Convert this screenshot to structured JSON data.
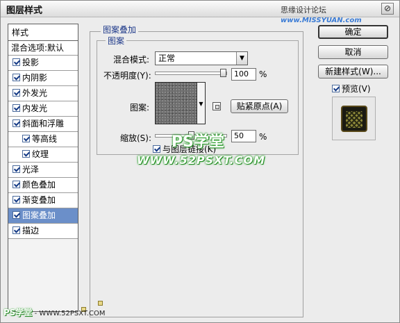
{
  "window": {
    "title": "图层样式",
    "watermark_top_text": "思缘设计论坛",
    "watermark_top_site": "www.MISSYUAN.com",
    "close_glyph": "⊘"
  },
  "sidebar": {
    "header": "样式",
    "blend_options": "混合选项:默认",
    "items": [
      {
        "label": "投影",
        "checked": true
      },
      {
        "label": "内阴影",
        "checked": true
      },
      {
        "label": "外发光",
        "checked": true
      },
      {
        "label": "内发光",
        "checked": true
      },
      {
        "label": "斜面和浮雕",
        "checked": true
      },
      {
        "label": "等高线",
        "checked": true,
        "sub": true
      },
      {
        "label": "纹理",
        "checked": true,
        "sub": true
      },
      {
        "label": "光泽",
        "checked": true
      },
      {
        "label": "颜色叠加",
        "checked": true
      },
      {
        "label": "渐变叠加",
        "checked": true
      },
      {
        "label": "图案叠加",
        "checked": true,
        "selected": true
      },
      {
        "label": "描边",
        "checked": true
      }
    ]
  },
  "panel": {
    "group_title": "图案叠加",
    "subgroup_title": "图案",
    "blend_mode_label": "混合模式:",
    "blend_mode_value": "正常",
    "opacity_label": "不透明度(Y):",
    "opacity_value": "100",
    "opacity_percent": 100,
    "percent_sign": "%",
    "pattern_label": "图案:",
    "snap_origin_button": "贴紧原点(A)",
    "scale_label": "缩放(S):",
    "scale_value": "50",
    "scale_percent": 50,
    "link_label": "与图层链接(K)",
    "link_checked": true
  },
  "buttons": {
    "ok": "确定",
    "cancel": "取消",
    "new_style": "新建样式(W)...",
    "preview_label": "预览(V)",
    "preview_checked": true
  },
  "watermarks": {
    "ps_school": "PS学堂",
    "url": "WWW.52PSXT.COM",
    "bottom_brand": "PS学堂",
    "bottom_url": "- WWW.52PSXT.COM"
  },
  "colors": {
    "selected_item_bg": "#6b8fc9",
    "group_title_color": "#1f3a8a",
    "watermark_green": "#2aa12a"
  }
}
